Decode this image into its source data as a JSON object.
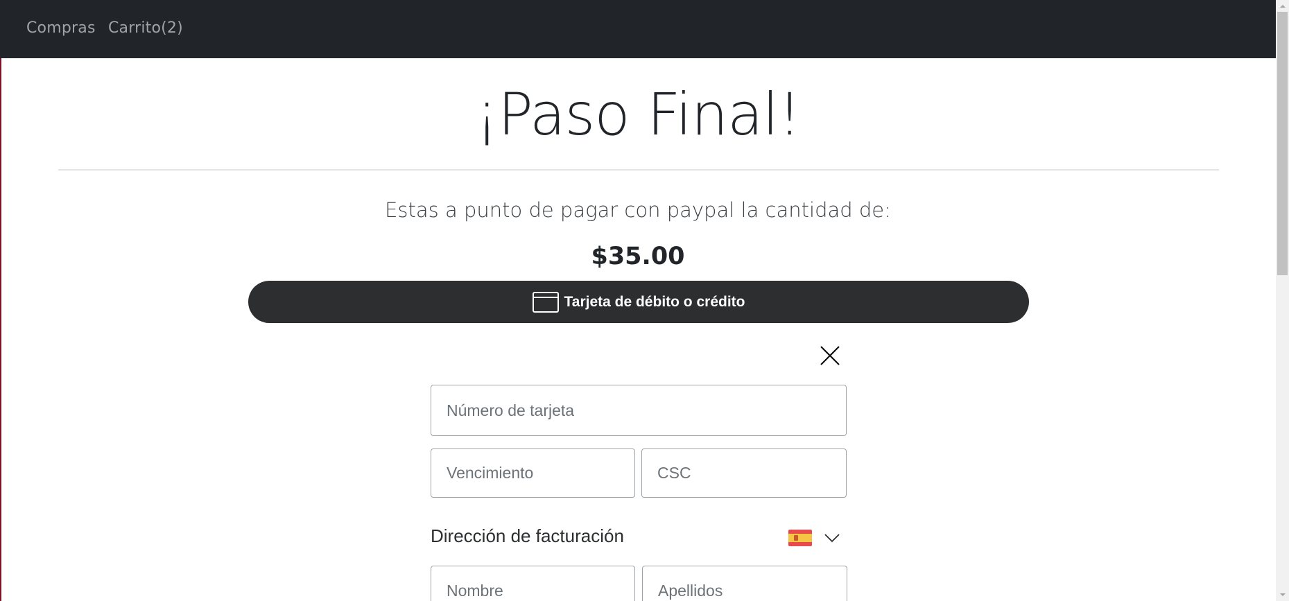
{
  "nav": {
    "links": [
      "Compras",
      "Carrito(2)"
    ]
  },
  "page": {
    "title": "¡Paso Final!",
    "subtitle": "Estas a punto de pagar con paypal la cantidad de:",
    "amount": "$35.00"
  },
  "payment": {
    "card_button_label": "Tarjeta de débito o crédito",
    "card_number_placeholder": "Número de tarjeta",
    "expiry_placeholder": "Vencimiento",
    "csc_placeholder": "CSC",
    "billing_heading": "Dirección de facturación",
    "country_flag": "spain-flag-icon",
    "first_name_placeholder": "Nombre",
    "last_name_placeholder": "Apellidos"
  },
  "colors": {
    "navbar": "#212529",
    "nav_link": "#a0a4a9",
    "pay_button": "#2c2e2f",
    "field_border": "#9da3a6"
  }
}
